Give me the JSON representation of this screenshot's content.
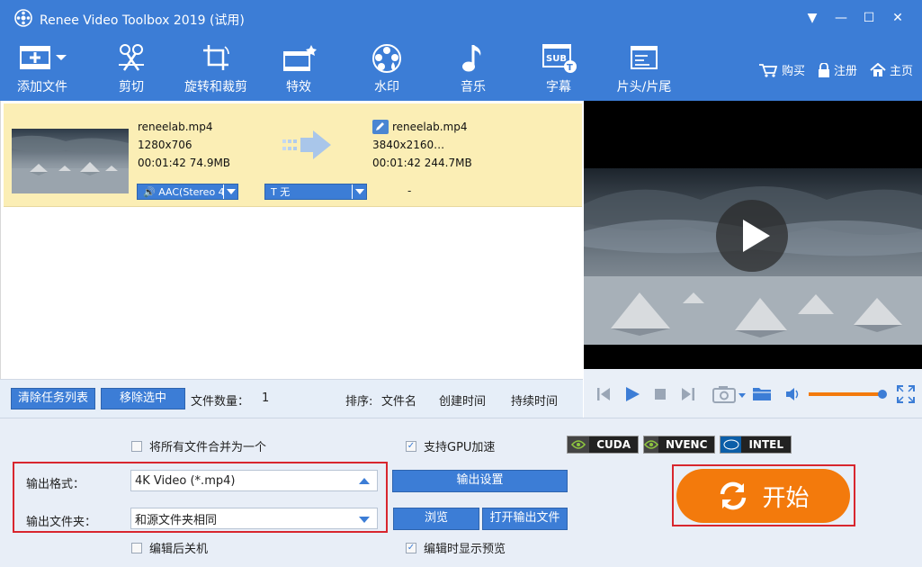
{
  "window": {
    "title": "Renee Video Toolbox 2019 (试用)",
    "controls": {
      "menu": "▼",
      "minimize": "—",
      "maximize": "☐",
      "close": "✕"
    }
  },
  "toolbar": {
    "items": [
      {
        "label": "添加文件",
        "icon": "add-file-icon"
      },
      {
        "label": "剪切",
        "icon": "scissors-icon"
      },
      {
        "label": "旋转和裁剪",
        "icon": "rotate-crop-icon"
      },
      {
        "label": "特效",
        "icon": "effects-icon"
      },
      {
        "label": "水印",
        "icon": "watermark-icon"
      },
      {
        "label": "音乐",
        "icon": "music-icon"
      },
      {
        "label": "字幕",
        "icon": "subtitle-icon"
      },
      {
        "label": "片头/片尾",
        "icon": "intro-outro-icon"
      }
    ],
    "right_links": [
      {
        "label": "购买",
        "icon": "cart-icon"
      },
      {
        "label": "注册",
        "icon": "lock-icon"
      },
      {
        "label": "主页",
        "icon": "home-icon"
      }
    ]
  },
  "file_list": {
    "items": [
      {
        "source": {
          "name": "reneelab.mp4",
          "resolution": "1280x706",
          "duration": "00:01:42",
          "size": "74.9MB"
        },
        "output": {
          "name": "reneelab.mp4",
          "resolution": "3840x2160…",
          "duration": "00:01:42",
          "size": "244.7MB"
        },
        "audio_track": "AAC(Stereo 4",
        "subtitle": "无",
        "subtitle_prefix": "T",
        "extra": "-"
      }
    ],
    "actions": {
      "clear_label": "清除任务列表",
      "remove_label": "移除选中",
      "count_label": "文件数量：",
      "count_value": "1",
      "sort_label": "排序:",
      "sort_options": [
        "文件名",
        "创建时间",
        "持续时间"
      ]
    }
  },
  "settings": {
    "merge_label": "将所有文件合并为一个",
    "merge_checked": false,
    "gpu_label": "支持GPU加速",
    "gpu_checked": true,
    "gpu_badges": [
      "CUDA",
      "NVENC",
      "INTEL"
    ],
    "output_format_label": "输出格式：",
    "output_format_value": "4K Video (*.mp4)",
    "output_folder_label": "输出文件夹：",
    "output_folder_value": "和源文件夹相同",
    "output_settings_label": "输出设置",
    "browse_label": "浏览",
    "open_output_label": "打开输出文件",
    "shutdown_label": "编辑后关机",
    "shutdown_checked": false,
    "preview_label": "编辑时显示预览",
    "preview_checked": true,
    "start_label": "开始"
  },
  "player": {
    "volume": 0.95
  },
  "colors": {
    "accent": "#3c7dd6",
    "selected_row": "#fbeeb5",
    "start_button": "#f37a0c",
    "highlight_box": "#d8262e"
  }
}
